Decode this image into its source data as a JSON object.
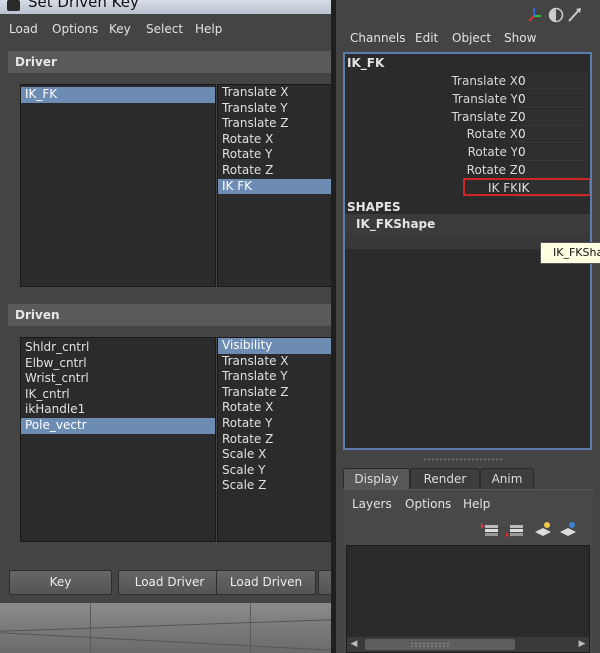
{
  "sdk_window": {
    "title": "Set Driven Key",
    "menus": [
      "Load",
      "Options",
      "Key",
      "Select",
      "Help"
    ],
    "driver": {
      "header": "Driver",
      "objects": [
        {
          "label": "IK_FK",
          "selected": true
        }
      ],
      "attributes": [
        {
          "label": "Translate X",
          "selected": false
        },
        {
          "label": "Translate Y",
          "selected": false
        },
        {
          "label": "Translate Z",
          "selected": false
        },
        {
          "label": "Rotate X",
          "selected": false
        },
        {
          "label": "Rotate Y",
          "selected": false
        },
        {
          "label": "Rotate Z",
          "selected": false
        },
        {
          "label": "IK FK",
          "selected": true
        }
      ]
    },
    "driven": {
      "header": "Driven",
      "objects": [
        {
          "label": "Shldr_cntrl",
          "selected": false
        },
        {
          "label": "Elbw_cntrl",
          "selected": false
        },
        {
          "label": "Wrist_cntrl",
          "selected": false
        },
        {
          "label": "IK_cntrl",
          "selected": false
        },
        {
          "label": "ikHandle1",
          "selected": false
        },
        {
          "label": "Pole_vectr",
          "selected": true
        }
      ],
      "attributes": [
        {
          "label": "Visibility",
          "selected": true
        },
        {
          "label": "Translate X",
          "selected": false
        },
        {
          "label": "Translate Y",
          "selected": false
        },
        {
          "label": "Translate Z",
          "selected": false
        },
        {
          "label": "Rotate X",
          "selected": false
        },
        {
          "label": "Rotate Y",
          "selected": false
        },
        {
          "label": "Rotate Z",
          "selected": false
        },
        {
          "label": "Scale X",
          "selected": false
        },
        {
          "label": "Scale Y",
          "selected": false
        },
        {
          "label": "Scale Z",
          "selected": false
        }
      ]
    },
    "buttons": {
      "key": "Key",
      "load_driver": "Load Driver",
      "load_driven": "Load Driven"
    }
  },
  "channel_box": {
    "menus": [
      "Channels",
      "Edit",
      "Object",
      "Show"
    ],
    "object_name": "IK_FK",
    "attributes": [
      {
        "label": "Translate X",
        "value": "0"
      },
      {
        "label": "Translate Y",
        "value": "0"
      },
      {
        "label": "Translate Z",
        "value": "0"
      },
      {
        "label": "Rotate X",
        "value": "0"
      },
      {
        "label": "Rotate Y",
        "value": "0"
      },
      {
        "label": "Rotate Z",
        "value": "0"
      },
      {
        "label": "IK FK",
        "value": "IK"
      }
    ],
    "shapes_header": "SHAPES",
    "shape_name": "IK_FKShape",
    "tooltip": "IK_FKShape",
    "tabs": [
      {
        "label": "Display",
        "active": true
      },
      {
        "label": "Render",
        "active": false
      },
      {
        "label": "Anim",
        "active": false
      }
    ],
    "layer_menus": [
      "Layers",
      "Options",
      "Help"
    ],
    "header_icons": [
      "axis-icon",
      "half-circle-icon",
      "arrow-icon"
    ],
    "layer_icons": [
      "new-layer-selected-icon",
      "new-layer-icon",
      "layer-add-icon",
      "layer-add-blue-icon"
    ]
  },
  "colors": {
    "selection": "#6c8cb4",
    "panel_bg": "#444444",
    "list_bg": "#2b2b2b",
    "highlight": "#d02525",
    "frame_border": "#5d7db0"
  }
}
